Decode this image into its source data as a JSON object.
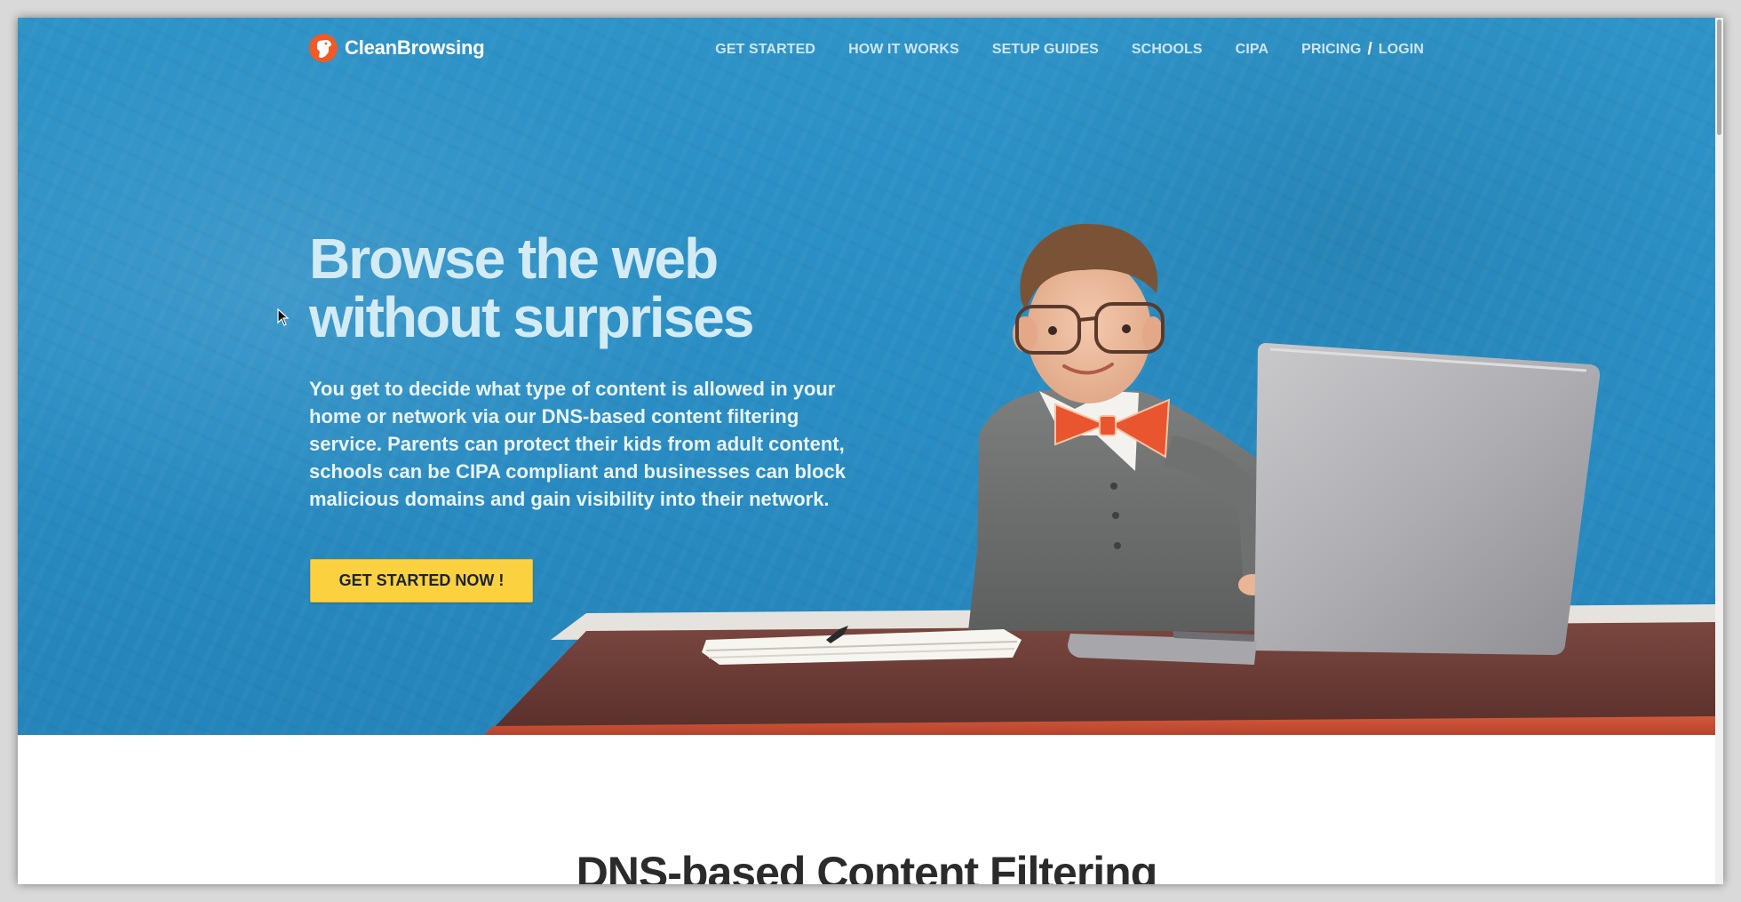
{
  "brand": {
    "name": "CleanBrowsing"
  },
  "nav": {
    "items": [
      {
        "label": "GET STARTED"
      },
      {
        "label": "HOW IT WORKS"
      },
      {
        "label": "SETUP GUIDES"
      },
      {
        "label": "SCHOOLS"
      },
      {
        "label": "CIPA"
      },
      {
        "label": "PRICING"
      }
    ],
    "separator": "/",
    "login": "LOGIN"
  },
  "hero": {
    "headline_line1": "Browse the web",
    "headline_line2": "without surprises",
    "intro": "You get to decide what type of content is allowed in your home or network via our DNS-based content filtering service. Parents can protect their kids from adult content, schools can be CIPA compliant and businesses can block malicious domains and gain visibility into their network.",
    "cta_label": "GET STARTED NOW !"
  },
  "section": {
    "title": "DNS-based Content Filtering"
  },
  "colors": {
    "hero_blue": "#2a8ec4",
    "cta_yellow": "#fbd140",
    "logo_orange": "#f15a24",
    "desk": "#6b3a33"
  },
  "icons": {
    "logo": "dog-head-logo-icon",
    "cursor": "mouse-pointer-icon"
  }
}
